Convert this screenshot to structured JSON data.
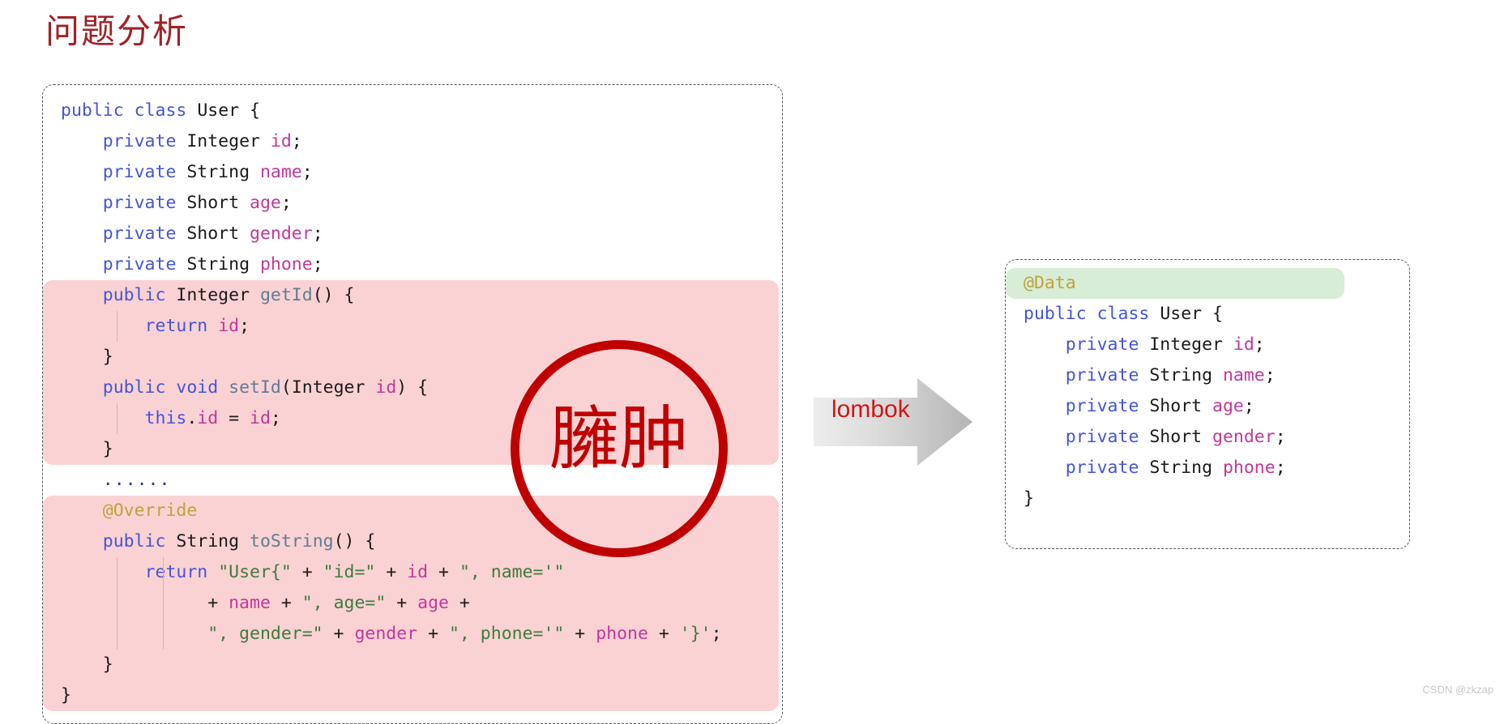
{
  "title": "问题分析",
  "watermark": "CSDN @zkzap",
  "arrow": {
    "label": "lombok",
    "color": "#C0C0C0",
    "label_color": "#D11414"
  },
  "annotation": {
    "text": "臃肿",
    "color": "#C00000",
    "shape": "circle"
  },
  "colors": {
    "title": "#A02226",
    "keyword": "#4455D6",
    "type": "#1A1A1A",
    "field": "#C2389B",
    "method": "#5E7C96",
    "string": "#3C7C3C",
    "annotation": "#BFA23C",
    "highlight_pink": "#FBD2D3",
    "highlight_green": "#D8EDD5"
  },
  "left_code": {
    "language": "java",
    "highlight": "pink",
    "lines": [
      {
        "text": "public class User {",
        "highlight": "none"
      },
      {
        "text": "    private Integer id;",
        "highlight": "none"
      },
      {
        "text": "    private String name;",
        "highlight": "none"
      },
      {
        "text": "    private Short age;",
        "highlight": "none"
      },
      {
        "text": "    private Short gender;",
        "highlight": "none"
      },
      {
        "text": "    private String phone;",
        "highlight": "none"
      },
      {
        "text": "    public Integer getId() {",
        "highlight": "pink"
      },
      {
        "text": "        return id;",
        "highlight": "pink"
      },
      {
        "text": "    }",
        "highlight": "pink"
      },
      {
        "text": "    public void setId(Integer id) {",
        "highlight": "pink"
      },
      {
        "text": "        this.id = id;",
        "highlight": "pink"
      },
      {
        "text": "    }",
        "highlight": "pink"
      },
      {
        "text": "    ......",
        "highlight": "none"
      },
      {
        "text": "    @Override",
        "highlight": "pink"
      },
      {
        "text": "    public String toString() {",
        "highlight": "pink"
      },
      {
        "text": "        return \"User{\" + \"id=\" + id + \", name='\"",
        "highlight": "pink"
      },
      {
        "text": "              + name + \", age=\" + age +",
        "highlight": "pink"
      },
      {
        "text": "              \", gender=\" + gender + \", phone='\" + phone + '}';",
        "highlight": "pink"
      },
      {
        "text": "    }",
        "highlight": "pink"
      },
      {
        "text": "}",
        "highlight": "pink"
      }
    ]
  },
  "right_code": {
    "language": "java",
    "highlight": "green",
    "lines": [
      {
        "text": "@Data",
        "highlight": "green"
      },
      {
        "text": "public class User {",
        "highlight": "none"
      },
      {
        "text": "    private Integer id;",
        "highlight": "none"
      },
      {
        "text": "    private String name;",
        "highlight": "none"
      },
      {
        "text": "    private Short age;",
        "highlight": "none"
      },
      {
        "text": "    private Short gender;",
        "highlight": "none"
      },
      {
        "text": "    private String phone;",
        "highlight": "none"
      },
      {
        "text": "}",
        "highlight": "none"
      }
    ]
  }
}
